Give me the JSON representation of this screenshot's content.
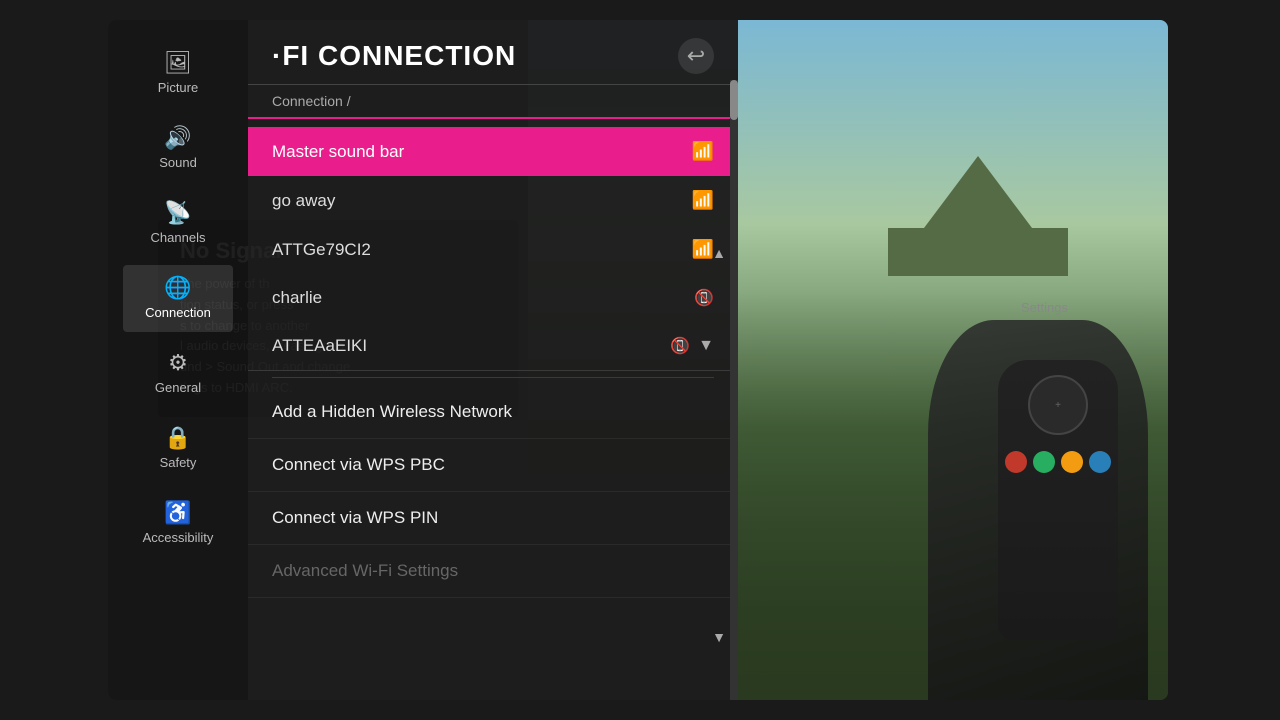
{
  "sidebar": {
    "items": [
      {
        "id": "picture",
        "label": "Picture",
        "icon": "🖼",
        "active": false
      },
      {
        "id": "sound",
        "label": "Sound",
        "icon": "🔊",
        "active": false
      },
      {
        "id": "channels",
        "label": "Channels",
        "icon": "📡",
        "active": false
      },
      {
        "id": "connection",
        "label": "Connection",
        "icon": "🌐",
        "active": true
      },
      {
        "id": "general",
        "label": "General",
        "icon": "⚙",
        "active": false
      },
      {
        "id": "safety",
        "label": "Safety",
        "icon": "🔒",
        "active": false
      },
      {
        "id": "accessibility",
        "label": "Accessibility",
        "icon": "♿",
        "active": false
      }
    ]
  },
  "panel": {
    "title": "·FI CONNECTION",
    "breadcrumb": "Connection /",
    "back_label": "↩"
  },
  "networks": [
    {
      "id": "master-sound-bar",
      "name": "Master sound bar",
      "signal": "strong",
      "selected": true
    },
    {
      "id": "go-away",
      "name": "go away",
      "signal": "strong",
      "selected": false
    },
    {
      "id": "attge79ci2",
      "name": "ATTGe79CI2",
      "signal": "strong",
      "selected": false
    },
    {
      "id": "charlie",
      "name": "charlie",
      "signal": "weak",
      "selected": false
    },
    {
      "id": "atteaaeiki",
      "name": "ATTEAaEIKI",
      "signal": "weak",
      "selected": false
    }
  ],
  "options": [
    {
      "id": "add-hidden",
      "label": "Add a Hidden Wireless Network",
      "disabled": false
    },
    {
      "id": "connect-wps-pbc",
      "label": "Connect via WPS PBC",
      "disabled": false
    },
    {
      "id": "connect-wps-pin",
      "label": "Connect via WPS PIN",
      "disabled": false
    },
    {
      "id": "advanced-wifi",
      "label": "Advanced Wi-Fi Settings",
      "disabled": true
    }
  ],
  "no_signal": {
    "title": "No Signal",
    "text": "the power of th\ntion status, or press\ns to change to another\nl audio devices, please go to\nund > Sound Out and change\ntings to HDMI ARC."
  },
  "settings_hint": "Settings"
}
